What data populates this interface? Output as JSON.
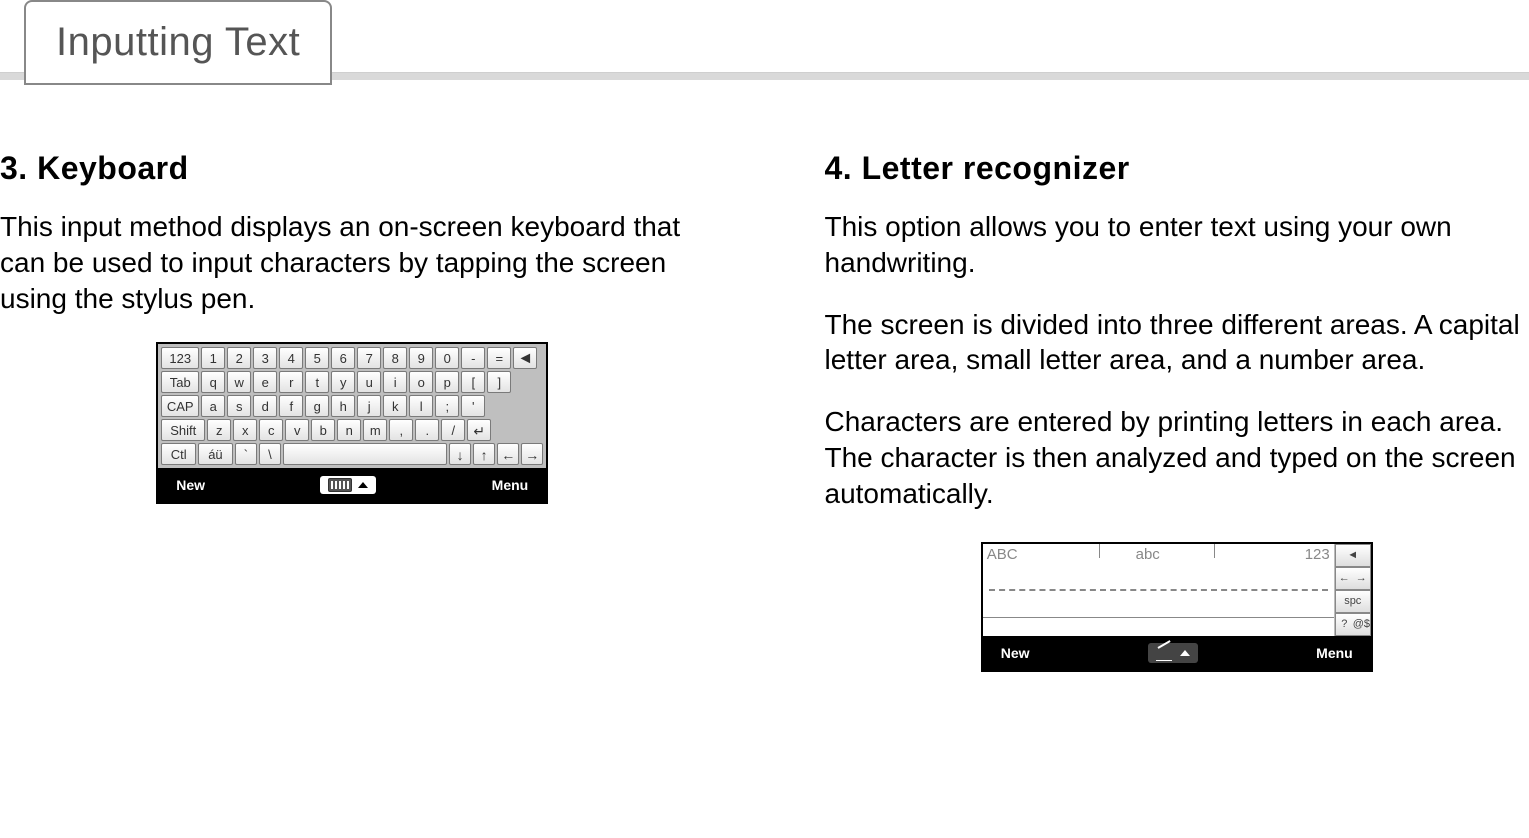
{
  "page_title": "Inputting Text",
  "left": {
    "heading": "3. Keyboard",
    "para1": "This input method displays an on-screen keyboard that can be used to input characters by tapping the screen using the stylus pen.",
    "keyboard_rows": [
      [
        "123",
        "1",
        "2",
        "3",
        "4",
        "5",
        "6",
        "7",
        "8",
        "9",
        "0",
        "-",
        "=",
        "◄"
      ],
      [
        "Tab",
        "q",
        "w",
        "e",
        "r",
        "t",
        "y",
        "u",
        "i",
        "o",
        "p",
        "[",
        "]"
      ],
      [
        "CAP",
        "a",
        "s",
        "d",
        "f",
        "g",
        "h",
        "j",
        "k",
        "l",
        ";",
        "'"
      ],
      [
        "Shift",
        "z",
        "x",
        "c",
        "v",
        "b",
        "n",
        "m",
        ",",
        ".",
        "/",
        "↵"
      ],
      [
        "Ctl",
        "áü",
        "`",
        "\\",
        " ",
        "↓",
        "↑",
        "←",
        "→"
      ]
    ],
    "bottom_bar": {
      "left": "New",
      "right": "Menu"
    }
  },
  "right": {
    "heading": "4. Letter recognizer",
    "para1": "This option allows you to enter text using your own handwriting.",
    "para2": "The screen is divided into three different areas. A capital letter area, small letter area, and a number area.",
    "para3": "Characters are entered by printing letters in each area. The character is then analyzed and typed on the screen automatically.",
    "area_labels": {
      "caps": "ABC",
      "lower": "abc",
      "num": "123"
    },
    "side_keys": {
      "bksp": "◄",
      "left": "←",
      "right": "→",
      "spc": "spc",
      "help": "?",
      "sym": "@$"
    },
    "bottom_bar": {
      "left": "New",
      "right": "Menu"
    }
  }
}
